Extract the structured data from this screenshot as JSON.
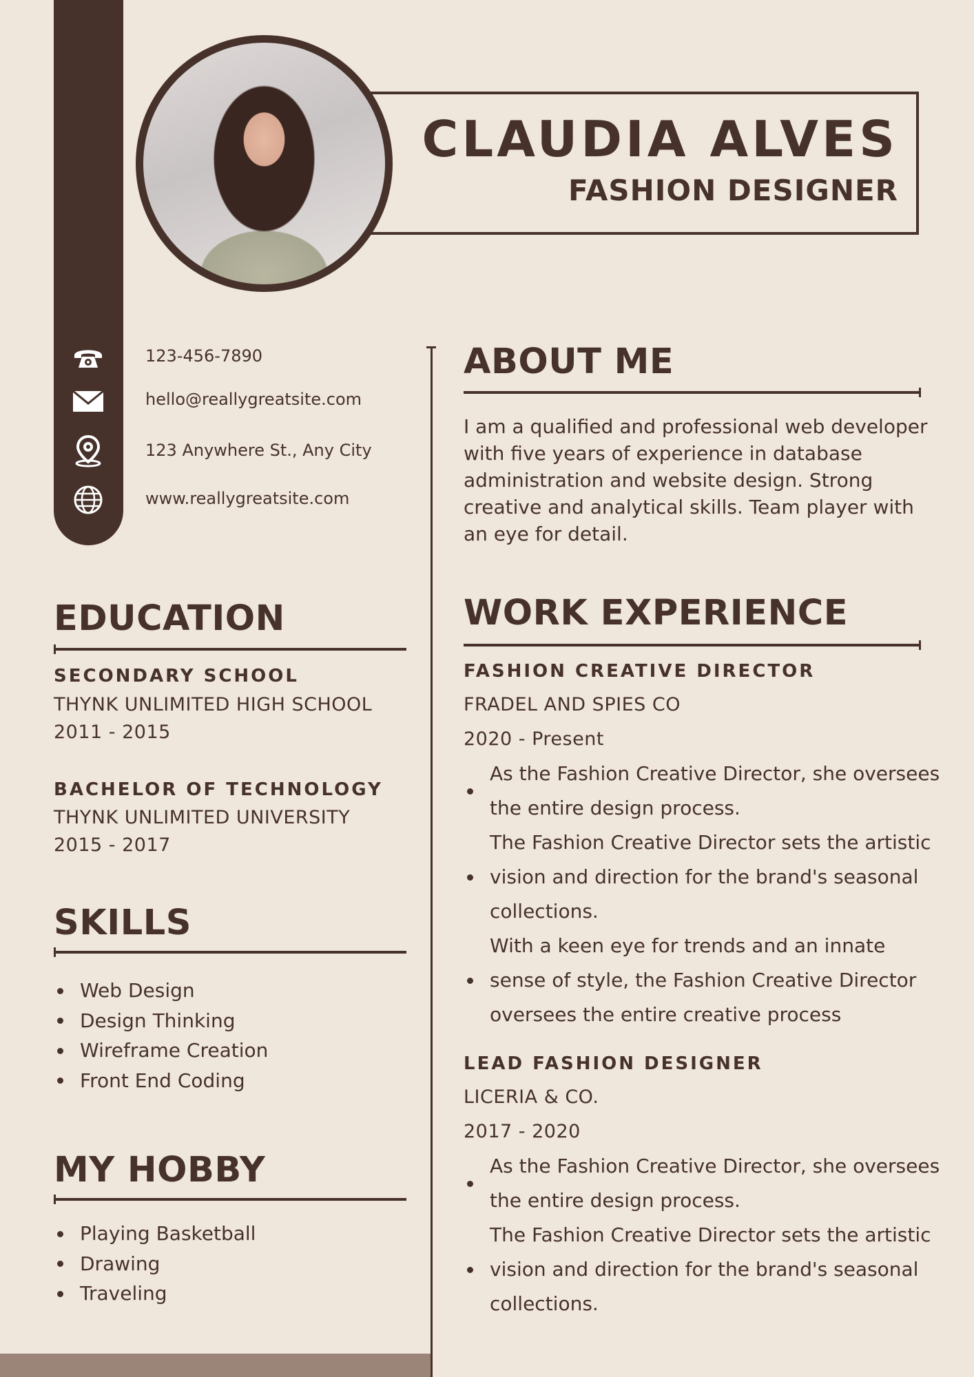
{
  "header": {
    "name": "CLAUDIA ALVES",
    "title": "FASHION DESIGNER"
  },
  "contact": {
    "phone": "123-456-7890",
    "email": "hello@reallygreatsite.com",
    "address": "123 Anywhere St., Any City",
    "website": "www.reallygreatsite.com",
    "icons": [
      "phone-icon",
      "mail-icon",
      "location-pin-icon",
      "globe-icon"
    ]
  },
  "about": {
    "heading": "ABOUT ME",
    "text": "I am a qualified and professional web developer with five years of experience in database administration and website design. Strong creative and analytical skills. Team player with an eye for detail."
  },
  "education": {
    "heading": "EDUCATION",
    "items": [
      {
        "degree": "SECONDARY SCHOOL",
        "school": "THYNK UNLIMITED HIGH SCHOOL",
        "years": "2011 - 2015"
      },
      {
        "degree": "BACHELOR OF TECHNOLOGY",
        "school": "THYNK UNLIMITED UNIVERSITY",
        "years": "2015 - 2017"
      }
    ]
  },
  "skills": {
    "heading": "SKILLS",
    "items": [
      "Web Design",
      "Design Thinking",
      "Wireframe Creation",
      "Front End Coding"
    ]
  },
  "hobby": {
    "heading": "MY HOBBY",
    "items": [
      "Playing Basketball",
      "Drawing",
      "Traveling"
    ]
  },
  "work": {
    "heading": "WORK EXPERIENCE",
    "jobs": [
      {
        "role": "FASHION CREATIVE DIRECTOR",
        "company": "FRADEL AND SPIES CO",
        "years": "2020 - Present",
        "duties": [
          "As the Fashion Creative Director, she oversees the entire design process.",
          "The Fashion Creative Director sets the artistic vision and direction for the brand's seasonal collections.",
          "With a keen eye for trends and an innate sense of style, the Fashion Creative Director oversees the entire creative process"
        ]
      },
      {
        "role": "LEAD FASHION DESIGNER",
        "company": "LICERIA & CO.",
        "years": "2017 - 2020",
        "duties": [
          "As the Fashion Creative Director, she oversees the entire design process.",
          "The Fashion Creative Director sets the artistic vision and direction for the brand's seasonal collections."
        ]
      }
    ]
  },
  "colors": {
    "background": "#f0e7dc",
    "primary": "#46322b",
    "accent": "#9b8579"
  }
}
